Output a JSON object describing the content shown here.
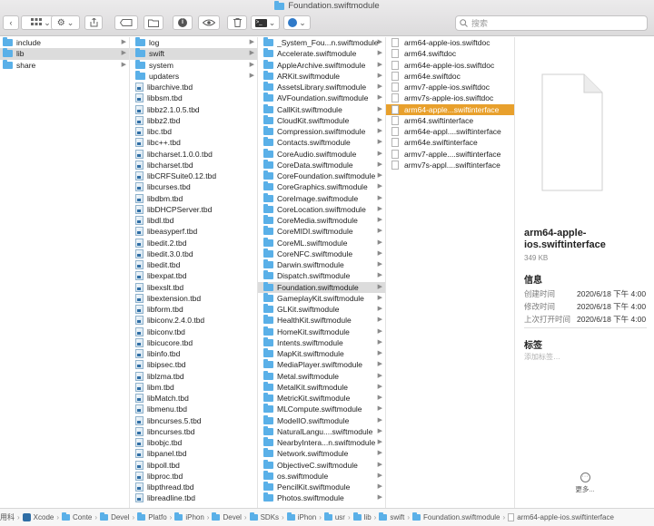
{
  "window": {
    "title": "Foundation.swiftmodule"
  },
  "search": {
    "placeholder": "搜索"
  },
  "colors": {
    "folder": "#5ab0e8",
    "selection": "#e8a02c",
    "selection_inactive": "#dcdcdc"
  },
  "columns": [
    {
      "items": [
        {
          "label": "include",
          "icon": "folder-icon",
          "arrow": true
        },
        {
          "label": "lib",
          "icon": "folder-icon",
          "arrow": true,
          "selected": true
        },
        {
          "label": "share",
          "icon": "folder-icon",
          "arrow": true
        }
      ]
    },
    {
      "items": [
        {
          "label": "log",
          "icon": "folder-icon",
          "arrow": true
        },
        {
          "label": "swift",
          "icon": "folder-icon",
          "arrow": true,
          "selected": true
        },
        {
          "label": "system",
          "icon": "folder-icon",
          "arrow": true
        },
        {
          "label": "updaters",
          "icon": "folder-icon",
          "arrow": true
        },
        {
          "label": "libarchive.tbd",
          "icon": "tbd-file-icon"
        },
        {
          "label": "libbsm.tbd",
          "icon": "tbd-file-icon"
        },
        {
          "label": "libbz2.1.0.5.tbd",
          "icon": "tbd-file-icon"
        },
        {
          "label": "libbz2.tbd",
          "icon": "tbd-file-icon"
        },
        {
          "label": "libc.tbd",
          "icon": "tbd-file-icon"
        },
        {
          "label": "libc++.tbd",
          "icon": "tbd-file-icon"
        },
        {
          "label": "libcharset.1.0.0.tbd",
          "icon": "tbd-file-icon"
        },
        {
          "label": "libcharset.tbd",
          "icon": "tbd-file-icon"
        },
        {
          "label": "libCRFSuite0.12.tbd",
          "icon": "tbd-file-icon"
        },
        {
          "label": "libcurses.tbd",
          "icon": "tbd-file-icon"
        },
        {
          "label": "libdbm.tbd",
          "icon": "tbd-file-icon"
        },
        {
          "label": "libDHCPServer.tbd",
          "icon": "tbd-file-icon"
        },
        {
          "label": "libdl.tbd",
          "icon": "tbd-file-icon"
        },
        {
          "label": "libeasyperf.tbd",
          "icon": "tbd-file-icon"
        },
        {
          "label": "libedit.2.tbd",
          "icon": "tbd-file-icon"
        },
        {
          "label": "libedit.3.0.tbd",
          "icon": "tbd-file-icon"
        },
        {
          "label": "libedit.tbd",
          "icon": "tbd-file-icon"
        },
        {
          "label": "libexpat.tbd",
          "icon": "tbd-file-icon"
        },
        {
          "label": "libexslt.tbd",
          "icon": "tbd-file-icon"
        },
        {
          "label": "libextension.tbd",
          "icon": "tbd-file-icon"
        },
        {
          "label": "libform.tbd",
          "icon": "tbd-file-icon"
        },
        {
          "label": "libiconv.2.4.0.tbd",
          "icon": "tbd-file-icon"
        },
        {
          "label": "libiconv.tbd",
          "icon": "tbd-file-icon"
        },
        {
          "label": "libicucore.tbd",
          "icon": "tbd-file-icon"
        },
        {
          "label": "libinfo.tbd",
          "icon": "tbd-file-icon"
        },
        {
          "label": "libipsec.tbd",
          "icon": "tbd-file-icon"
        },
        {
          "label": "liblzma.tbd",
          "icon": "tbd-file-icon"
        },
        {
          "label": "libm.tbd",
          "icon": "tbd-file-icon"
        },
        {
          "label": "libMatch.tbd",
          "icon": "tbd-file-icon"
        },
        {
          "label": "libmenu.tbd",
          "icon": "tbd-file-icon"
        },
        {
          "label": "libncurses.5.tbd",
          "icon": "tbd-file-icon"
        },
        {
          "label": "libncurses.tbd",
          "icon": "tbd-file-icon"
        },
        {
          "label": "libobjc.tbd",
          "icon": "tbd-file-icon"
        },
        {
          "label": "libpanel.tbd",
          "icon": "tbd-file-icon"
        },
        {
          "label": "libpoll.tbd",
          "icon": "tbd-file-icon"
        },
        {
          "label": "libproc.tbd",
          "icon": "tbd-file-icon"
        },
        {
          "label": "libpthread.tbd",
          "icon": "tbd-file-icon"
        },
        {
          "label": "libreadline.tbd",
          "icon": "tbd-file-icon"
        }
      ]
    },
    {
      "items": [
        {
          "label": "_System_Fou...n.swiftmodule",
          "icon": "folder-icon",
          "arrow": true
        },
        {
          "label": "Accelerate.swiftmodule",
          "icon": "folder-icon",
          "arrow": true
        },
        {
          "label": "AppleArchive.swiftmodule",
          "icon": "folder-icon",
          "arrow": true
        },
        {
          "label": "ARKit.swiftmodule",
          "icon": "folder-icon",
          "arrow": true
        },
        {
          "label": "AssetsLibrary.swiftmodule",
          "icon": "folder-icon",
          "arrow": true
        },
        {
          "label": "AVFoundation.swiftmodule",
          "icon": "folder-icon",
          "arrow": true
        },
        {
          "label": "CallKit.swiftmodule",
          "icon": "folder-icon",
          "arrow": true
        },
        {
          "label": "CloudKit.swiftmodule",
          "icon": "folder-icon",
          "arrow": true
        },
        {
          "label": "Compression.swiftmodule",
          "icon": "folder-icon",
          "arrow": true
        },
        {
          "label": "Contacts.swiftmodule",
          "icon": "folder-icon",
          "arrow": true
        },
        {
          "label": "CoreAudio.swiftmodule",
          "icon": "folder-icon",
          "arrow": true
        },
        {
          "label": "CoreData.swiftmodule",
          "icon": "folder-icon",
          "arrow": true
        },
        {
          "label": "CoreFoundation.swiftmodule",
          "icon": "folder-icon",
          "arrow": true
        },
        {
          "label": "CoreGraphics.swiftmodule",
          "icon": "folder-icon",
          "arrow": true
        },
        {
          "label": "CoreImage.swiftmodule",
          "icon": "folder-icon",
          "arrow": true
        },
        {
          "label": "CoreLocation.swiftmodule",
          "icon": "folder-icon",
          "arrow": true
        },
        {
          "label": "CoreMedia.swiftmodule",
          "icon": "folder-icon",
          "arrow": true
        },
        {
          "label": "CoreMIDI.swiftmodule",
          "icon": "folder-icon",
          "arrow": true
        },
        {
          "label": "CoreML.swiftmodule",
          "icon": "folder-icon",
          "arrow": true
        },
        {
          "label": "CoreNFC.swiftmodule",
          "icon": "folder-icon",
          "arrow": true
        },
        {
          "label": "Darwin.swiftmodule",
          "icon": "folder-icon",
          "arrow": true
        },
        {
          "label": "Dispatch.swiftmodule",
          "icon": "folder-icon",
          "arrow": true
        },
        {
          "label": "Foundation.swiftmodule",
          "icon": "folder-icon",
          "arrow": true,
          "selected": true
        },
        {
          "label": "GameplayKit.swiftmodule",
          "icon": "folder-icon",
          "arrow": true
        },
        {
          "label": "GLKit.swiftmodule",
          "icon": "folder-icon",
          "arrow": true
        },
        {
          "label": "HealthKit.swiftmodule",
          "icon": "folder-icon",
          "arrow": true
        },
        {
          "label": "HomeKit.swiftmodule",
          "icon": "folder-icon",
          "arrow": true
        },
        {
          "label": "Intents.swiftmodule",
          "icon": "folder-icon",
          "arrow": true
        },
        {
          "label": "MapKit.swiftmodule",
          "icon": "folder-icon",
          "arrow": true
        },
        {
          "label": "MediaPlayer.swiftmodule",
          "icon": "folder-icon",
          "arrow": true
        },
        {
          "label": "Metal.swiftmodule",
          "icon": "folder-icon",
          "arrow": true
        },
        {
          "label": "MetalKit.swiftmodule",
          "icon": "folder-icon",
          "arrow": true
        },
        {
          "label": "MetricKit.swiftmodule",
          "icon": "folder-icon",
          "arrow": true
        },
        {
          "label": "MLCompute.swiftmodule",
          "icon": "folder-icon",
          "arrow": true
        },
        {
          "label": "ModelIO.swiftmodule",
          "icon": "folder-icon",
          "arrow": true
        },
        {
          "label": "NaturalLangu....swiftmodule",
          "icon": "folder-icon",
          "arrow": true
        },
        {
          "label": "NearbyIntera...n.swiftmodule",
          "icon": "folder-icon",
          "arrow": true
        },
        {
          "label": "Network.swiftmodule",
          "icon": "folder-icon",
          "arrow": true
        },
        {
          "label": "ObjectiveC.swiftmodule",
          "icon": "folder-icon",
          "arrow": true
        },
        {
          "label": "os.swiftmodule",
          "icon": "folder-icon",
          "arrow": true
        },
        {
          "label": "PencilKit.swiftmodule",
          "icon": "folder-icon",
          "arrow": true
        },
        {
          "label": "Photos.swiftmodule",
          "icon": "folder-icon",
          "arrow": true
        }
      ]
    },
    {
      "items": [
        {
          "label": "arm64-apple-ios.swiftdoc",
          "icon": "document-icon"
        },
        {
          "label": "arm64.swiftdoc",
          "icon": "document-icon"
        },
        {
          "label": "arm64e-apple-ios.swiftdoc",
          "icon": "document-icon"
        },
        {
          "label": "arm64e.swiftdoc",
          "icon": "document-icon"
        },
        {
          "label": "armv7-apple-ios.swiftdoc",
          "icon": "document-icon"
        },
        {
          "label": "armv7s-apple-ios.swiftdoc",
          "icon": "document-icon"
        },
        {
          "label": "arm64-apple...swiftinterface",
          "icon": "document-icon",
          "active": true
        },
        {
          "label": "arm64.swiftinterface",
          "icon": "document-icon"
        },
        {
          "label": "arm64e-appl....swiftinterface",
          "icon": "document-icon"
        },
        {
          "label": "arm64e.swiftinterface",
          "icon": "document-icon"
        },
        {
          "label": "armv7-apple....swiftinterface",
          "icon": "document-icon"
        },
        {
          "label": "armv7s-appl....swiftinterface",
          "icon": "document-icon"
        }
      ]
    }
  ],
  "preview": {
    "file_name": "arm64-apple-ios.swiftinterface",
    "file_size": "349 KB",
    "info_heading": "信息",
    "info": [
      {
        "key": "创建时间",
        "value": "2020/6/18 下午 4:00"
      },
      {
        "key": "修改时间",
        "value": "2020/6/18 下午 4:00"
      },
      {
        "key": "上次打开时间",
        "value": "2020/6/18 下午 4:00"
      }
    ],
    "tags_heading": "标签",
    "tags_placeholder": "添加标签…",
    "more_label": "更多..."
  },
  "pathbar": [
    {
      "label": "用科",
      "icon": "none"
    },
    {
      "label": "Xcode",
      "icon": "xcode-icon"
    },
    {
      "label": "Conte",
      "icon": "folder-icon"
    },
    {
      "label": "Devel",
      "icon": "folder-icon"
    },
    {
      "label": "Platfo",
      "icon": "folder-icon"
    },
    {
      "label": "iPhon",
      "icon": "folder-icon"
    },
    {
      "label": "Devel",
      "icon": "folder-icon"
    },
    {
      "label": "SDKs",
      "icon": "folder-icon"
    },
    {
      "label": "iPhon",
      "icon": "folder-icon"
    },
    {
      "label": "usr",
      "icon": "folder-icon"
    },
    {
      "label": "lib",
      "icon": "folder-icon"
    },
    {
      "label": "swift",
      "icon": "folder-icon"
    },
    {
      "label": "Foundation.swiftmodule",
      "icon": "folder-icon"
    },
    {
      "label": "arm64-apple-ios.swiftinterface",
      "icon": "document-icon"
    }
  ]
}
